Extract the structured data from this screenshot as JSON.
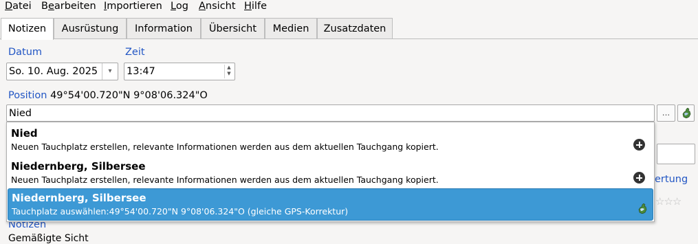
{
  "menubar": {
    "items": [
      {
        "label": "Datei",
        "mnemonic": "D",
        "rest": "atei"
      },
      {
        "label": "Bearbeiten",
        "mnemonic": "e",
        "pre": "B",
        "rest": "arbeiten"
      },
      {
        "label": "Importieren",
        "mnemonic": "I",
        "rest": "mportieren"
      },
      {
        "label": "Log",
        "mnemonic": "L",
        "rest": "og"
      },
      {
        "label": "Ansicht",
        "mnemonic": "A",
        "rest": "nsicht"
      },
      {
        "label": "Hilfe",
        "mnemonic": "H",
        "rest": "ilfe"
      }
    ]
  },
  "tabs": [
    {
      "label": "Notizen",
      "active": true
    },
    {
      "label": "Ausrüstung"
    },
    {
      "label": "Information"
    },
    {
      "label": "Übersicht"
    },
    {
      "label": "Medien"
    },
    {
      "label": "Zusatzdaten"
    }
  ],
  "form": {
    "date_label": "Datum",
    "date_value": "So. 10. Aug. 2025",
    "time_label": "Zeit",
    "time_value": "13:47",
    "position_label": "Position",
    "position_value": "49°54'00.720\"N 9°08'06.324\"O",
    "location_value": "Nied",
    "browse_button": "...",
    "rating_label_partial": "ertung",
    "notes_label": "Notizen",
    "notes_partial": "Gemäßigte Sicht"
  },
  "autocomplete": {
    "items": [
      {
        "title": "Nied",
        "description": "Neuen Tauchplatz erstellen, relevante Informationen werden aus dem aktuellen Tauchgang kopiert.",
        "icon": "plus-icon"
      },
      {
        "title": "Niedernberg, Silbersee",
        "description": "Neuen Tauchplatz erstellen, relevante Informationen werden aus dem aktuellen Tauchgang kopiert.",
        "icon": "plus-icon"
      },
      {
        "title": "Niedernberg, Silbersee",
        "description": "Tauchplatz auswählen:49°54'00.720\"N 9°08'06.324\"O (gleiche GPS-Korrektur)",
        "icon": "globe-icon",
        "selected": true
      }
    ]
  },
  "colors": {
    "label_blue": "#2256c4",
    "selection_blue": "#3d99d5",
    "window_bg": "#f6f5f4"
  }
}
